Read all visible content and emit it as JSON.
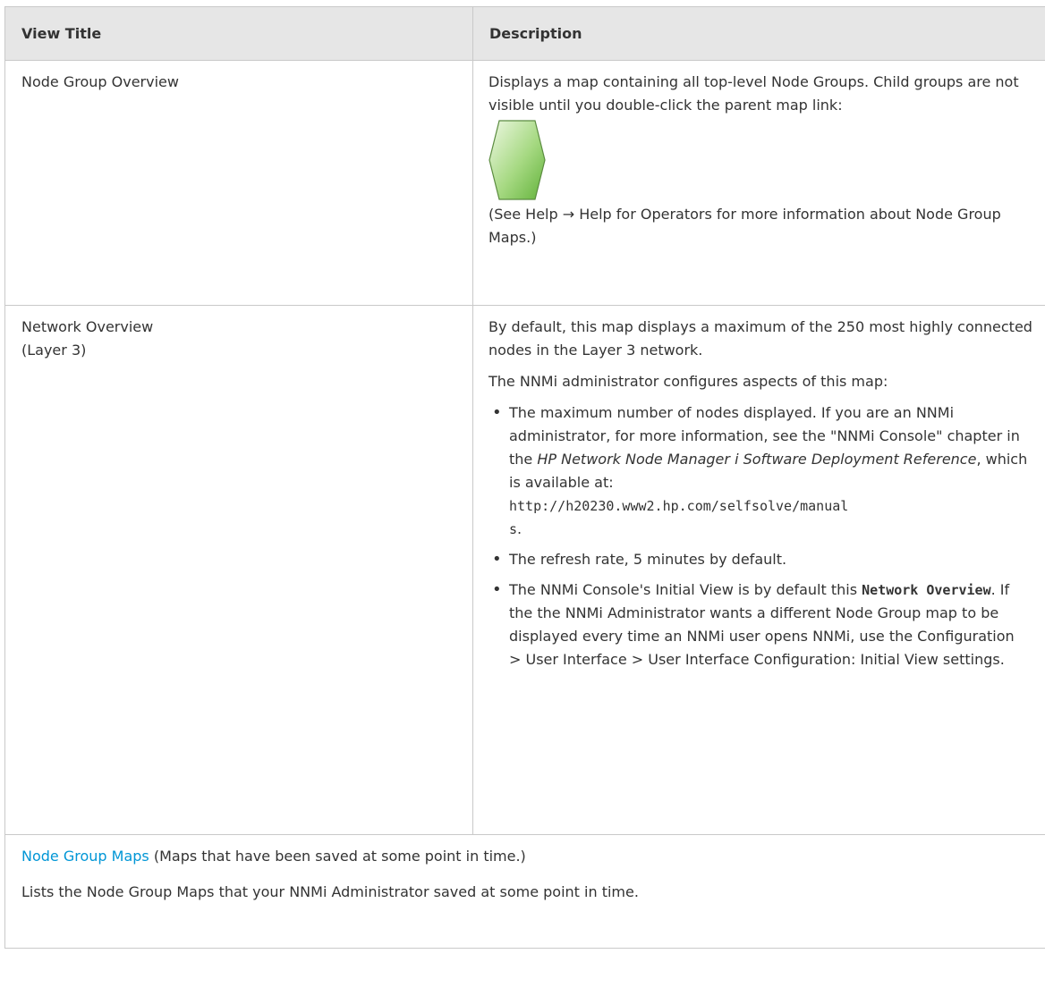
{
  "headers": {
    "col1": "View Title",
    "col2": "Description"
  },
  "row1": {
    "title": "Node Group Overview",
    "desc_text": "Displays a map containing all top-level Node Groups. Child groups are not visible until you double-click the parent map link:",
    "icon": "node-group-hexagon-icon",
    "icon_colors": {
      "fill_top": "#e6f4d6",
      "fill_bottom": "#6dbe45",
      "stroke": "#5b8c40"
    },
    "note": "(See Help → Help for Operators for more information about Node Group Maps.)"
  },
  "row2": {
    "title_line1": "Network Overview",
    "title_line2": "(Layer 3)",
    "para1": "By default, this map displays a maximum of the 250 most highly connected nodes in the Layer 3 network.",
    "para2": "The NNMi administrator configures aspects of this map:",
    "bullet1_a": "The maximum number of nodes displayed. If you are an NNMi administrator, for more information, see the \"NNMi Console\" chapter in the ",
    "bullet1_italic": "HP Network Node Manager i Software Deployment Reference",
    "bullet1_b": ", which is available at:",
    "bullet1_url_line1": "http://h20230.www2.hp.com/selfsolve/manual",
    "bullet1_url_line2": "s",
    "bullet1_end": ".",
    "bullet2": "The refresh rate, 5 minutes by default.",
    "bullet3_a": "The NNMi Console's Initial View is by default this ",
    "bullet3_bold": "Network Overview",
    "bullet3_b": ". If the the NNMi Administrator wants a different Node Group map to be displayed every time an NNMi user opens NNMi, use the Configuration > User Interface > User Interface Configuration: Initial View settings."
  },
  "row3": {
    "link": "Node Group Maps",
    "link_suffix": " (Maps that have been saved at some point in time.)",
    "desc": "Lists the Node Group Maps that your NNMi Administrator saved at some point in time."
  },
  "colors": {
    "header_bg": "#e6e6e6",
    "border": "#c9c9c9",
    "link": "#0096d6",
    "text": "#333333"
  }
}
